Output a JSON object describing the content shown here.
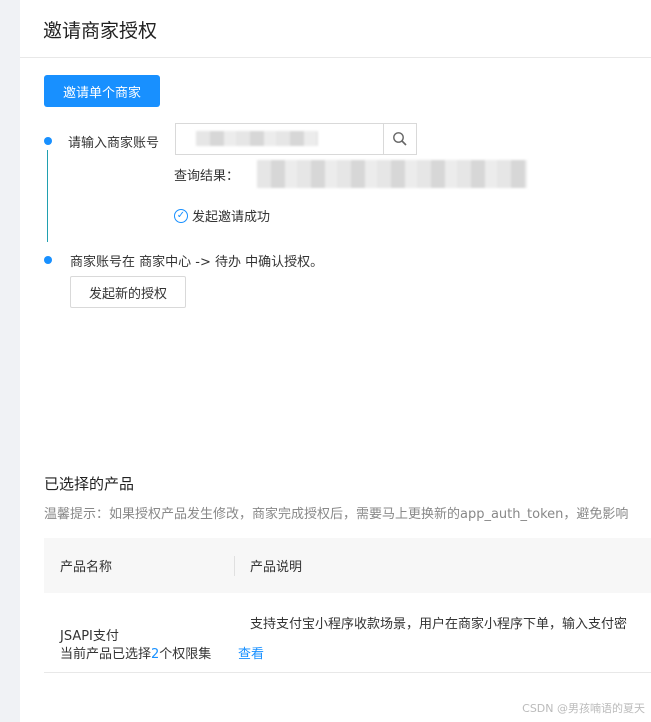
{
  "header": {
    "title": "邀请商家授权"
  },
  "actions": {
    "invite_single": "邀请单个商家",
    "new_authorization": "发起新的授权"
  },
  "steps": {
    "account_label": "请输入商家账号",
    "query_result_label": "查询结果：",
    "success_text": "发起邀请成功",
    "confirm_text": "商家账号在 商家中心 -> 待办 中确认授权。"
  },
  "search": {
    "value": "",
    "placeholder": ""
  },
  "products": {
    "title": "已选择的产品",
    "tip": "温馨提示：如果授权产品发生修改，商家完成授权后，需要马上更换新的app_auth_token，避免影响",
    "columns": [
      "产品名称",
      "产品说明"
    ],
    "rows": [
      {
        "name": "JSAPI支付",
        "selected_prefix": "当前产品已选择",
        "selected_count": "2",
        "selected_suffix": "个权限集",
        "view_link": "查看",
        "description": "支持支付宝小程序收款场景，用户在商家小程序下单，输入支付密"
      }
    ]
  },
  "watermark": "CSDN @男孩喃语的夏天",
  "colors": {
    "primary": "#1890ff",
    "step_line": "#20a0b0"
  },
  "icons": [
    "search-icon",
    "check-circle-icon"
  ]
}
